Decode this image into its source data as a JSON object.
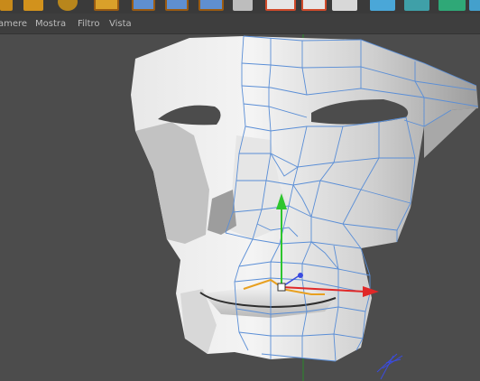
{
  "menu": {
    "items": [
      {
        "label": "amere"
      },
      {
        "label": "Mostra"
      },
      {
        "label": "Filtro"
      },
      {
        "label": "Vista"
      }
    ]
  },
  "toolbar": {
    "buttons": [
      {
        "icon": "move-icon"
      },
      {
        "icon": "rotate-icon"
      },
      {
        "icon": "undo-icon"
      },
      {
        "icon": "lock-x-axis-icon"
      },
      {
        "icon": "lock-y-axis-icon"
      },
      {
        "icon": "lock-z-axis-icon"
      },
      {
        "icon": "coordinate-system-icon"
      },
      {
        "icon": "arrow-right-icon"
      },
      {
        "icon": "render-view-icon"
      },
      {
        "icon": "render-picture-viewer-icon"
      },
      {
        "icon": "render-settings-icon"
      },
      {
        "icon": "cube-primitive-icon"
      },
      {
        "icon": "generator-icon"
      },
      {
        "icon": "deformer-icon"
      }
    ]
  },
  "viewport": {
    "object": "face-mesh",
    "selection": "edge-loop-mouth",
    "colors": {
      "background": "#4c4c4c",
      "mesh_wire": "#5a8ed6",
      "x_axis": "#e02828",
      "y_axis": "#2ec52e",
      "z_axis": "#3a4be0",
      "selection": "#e8a020"
    }
  }
}
